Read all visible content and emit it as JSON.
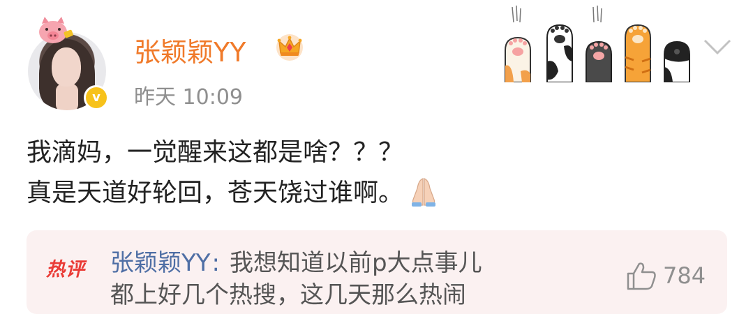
{
  "post": {
    "username": "张颖颖YY",
    "timestamp": "昨天 10:09",
    "verified_mark": "v",
    "content_lines": [
      "我滴妈，一觉醒来这都是啥？？？",
      "真是天道好轮回，苍天饶过谁啊。"
    ]
  },
  "hot_comment": {
    "tag": "热评",
    "author": "张颖颖YY",
    "separator": ":",
    "text_line1": "我想知道以前p大点事儿",
    "text_line2": "都上好几个热搜，这几天那么热闹",
    "likes": "784"
  },
  "icons": {
    "avatar_decoration": "pig-icon",
    "crown": "crown-icon",
    "paws": "cat-paws-sticker",
    "menu": "chevron-down-icon",
    "emoji": "praying-hands-icon",
    "like": "thumbs-up-icon"
  },
  "colors": {
    "username": "#f07a2a",
    "verified": "#f7c21b",
    "hot_tag": "#ea3b36",
    "comment_author": "#4f6fa5",
    "hot_background": "#fbf1f1"
  }
}
